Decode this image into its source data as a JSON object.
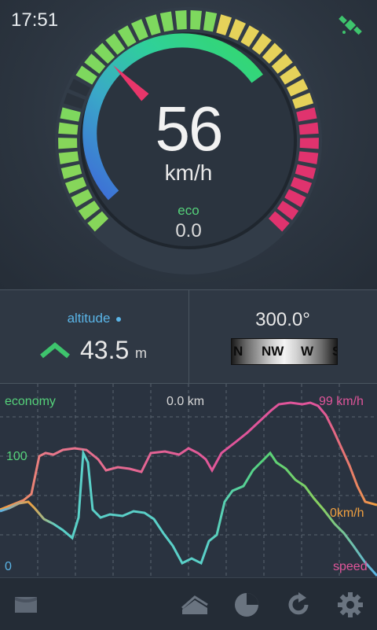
{
  "status": {
    "time": "17:51"
  },
  "gauge": {
    "speed": "56",
    "unit": "km/h",
    "eco_label": "eco",
    "eco_value": "0.0",
    "needle_kmh": 56
  },
  "altitude": {
    "label": "altitude",
    "value": "43.5",
    "unit": "m"
  },
  "compass": {
    "heading": "300.0°",
    "letters": [
      "N",
      "NW",
      "W",
      "S"
    ]
  },
  "chart": {
    "left_top_label": "economy",
    "left_mid_label": "100",
    "left_bottom_label": "0",
    "center_label": "0.0 km",
    "right_top_label": "99 km/h",
    "right_mid_label": "0km/h",
    "right_bottom_label": "speed",
    "colors": {
      "economy": "#55d27a",
      "speed": "#e0559a",
      "orange": "#f0a040",
      "cyan": "#5ad0c8"
    }
  },
  "nav": {
    "items": [
      "map-icon",
      "route-icon",
      "stats-icon",
      "refresh-icon",
      "settings-icon"
    ]
  }
}
